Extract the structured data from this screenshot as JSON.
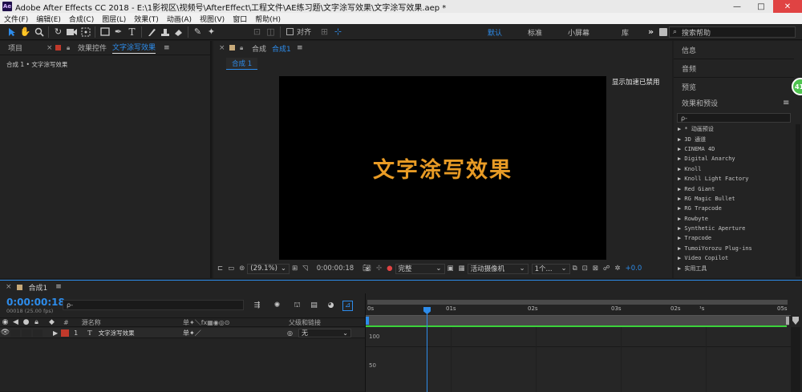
{
  "window": {
    "title": "Adobe After Effects CC 2018 - E:\\1影视区\\视频号\\AfterEffect\\工程文件\\AE练习题\\文字涂写效果\\文字涂写效果.aep *",
    "logo": "Ae",
    "minimize": "—",
    "maximize": "□",
    "close": "✕"
  },
  "menu": [
    "文件(F)",
    "编辑(E)",
    "合成(C)",
    "图层(L)",
    "效果(T)",
    "动画(A)",
    "视图(V)",
    "窗口",
    "帮助(H)"
  ],
  "toolbar": {
    "snap_label": "对齐",
    "workspaces": [
      "默认",
      "标准",
      "小屏幕",
      "库"
    ],
    "workspace_active": "默认",
    "more": "»",
    "search_placeholder": "搜索帮助"
  },
  "left_panel": {
    "tab_project": "项目",
    "tab_effect_controls": "效果控件",
    "effect_controls_target": "文字涂写效果",
    "breadcrumb": "合成 1 • 文字涂写效果"
  },
  "comp_panel": {
    "tab_label": "合成",
    "comp_name": "合成1",
    "sub_tab": "合成 1",
    "accel_msg": "显示加速已禁用",
    "canvas_text": "文字涂写效果",
    "zoom": "(29.1%)",
    "timecode": "0:00:00:18",
    "resolution": "完整",
    "camera": "活动摄像机",
    "views": "1个...",
    "exposure": "+0.0"
  },
  "right_panel": {
    "info": "信息",
    "audio": "音频",
    "preview": "预览",
    "effects_presets": "效果和预设",
    "search_placeholder": "ρ-",
    "effects": [
      "▶ * 动画预设",
      "▶ 3D 通道",
      "▶ CINEMA 4D",
      "▶ Digital Anarchy",
      "▶ Knoll",
      "▶ Knoll Light Factory",
      "▶ Red Giant",
      "▶ RG Magic Bullet",
      "▶ RG Trapcode",
      "▶ Rowbyte",
      "▶ Synthetic Aperture",
      "▶ Trapcode",
      "▶ TumoiYorozu Plug-ins",
      "▶ Video Copilot",
      "▶ 实用工具"
    ],
    "badge": "41"
  },
  "timeline": {
    "comp_tab": "合成1",
    "timecode": "0:00:00:18",
    "frame_info": "00018 (25.00 fps)",
    "search_placeholder": "ρ-",
    "col_num": "#",
    "col_source": "源名称",
    "col_switches": "单✦＼fx▦◉◎⊙",
    "col_parent": "父级和链接",
    "layer": {
      "index": "1",
      "type": "T",
      "name": "文字涂写效果",
      "switches": "单✦／",
      "parent": "无"
    },
    "ruler": [
      "0s",
      "01s",
      "02s",
      "03s",
      "02s",
      "05s"
    ],
    "ruler_extra": "¹s",
    "graph_labels": [
      "100",
      "50"
    ]
  },
  "colors": {
    "accent": "#2d8ceb",
    "canvas_text": "#e89b25",
    "label_red": "#c0392b",
    "label_tan": "#c7a979",
    "green_line": "#3bd23b"
  }
}
